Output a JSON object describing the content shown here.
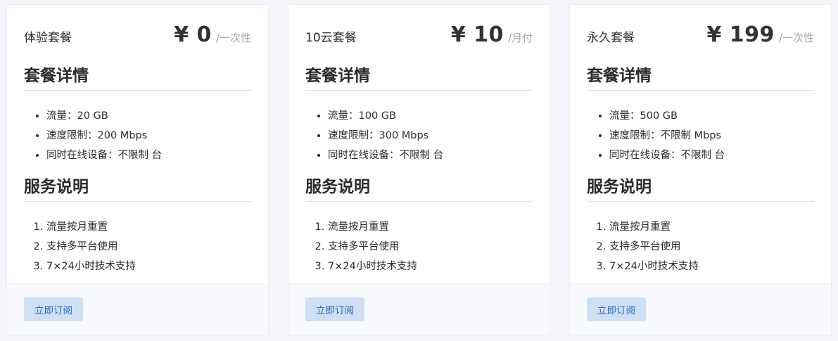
{
  "plans": [
    {
      "name": "体验套餐",
      "price": "¥ 0",
      "price_unit": "/一次性",
      "details_title": "套餐详情",
      "features": [
        "流量：20 GB",
        "速度限制：200 Mbps",
        "同时在线设备：不限制 台"
      ],
      "service_title": "服务说明",
      "services": [
        "流量按月重置",
        "支持多平台使用",
        "7×24小时技术支持"
      ],
      "subscribe_label": "立即订阅"
    },
    {
      "name": "10云套餐",
      "price": "¥ 10",
      "price_unit": "/月付",
      "details_title": "套餐详情",
      "features": [
        "流量：100 GB",
        "速度限制：300 Mbps",
        "同时在线设备：不限制 台"
      ],
      "service_title": "服务说明",
      "services": [
        "流量按月重置",
        "支持多平台使用",
        "7×24小时技术支持"
      ],
      "subscribe_label": "立即订阅"
    },
    {
      "name": "永久套餐",
      "price": "¥ 199",
      "price_unit": "/一次性",
      "details_title": "套餐详情",
      "features": [
        "流量：500 GB",
        "速度限制：不限制 Mbps",
        "同时在线设备：不限制 台"
      ],
      "service_title": "服务说明",
      "services": [
        "流量按月重置",
        "支持多平台使用",
        "7×24小时技术支持"
      ],
      "subscribe_label": "立即订阅"
    }
  ],
  "colors": {
    "button_bg": "#cfe0f5",
    "button_text": "#2f6cb8",
    "page_bg": "#f4f5fa"
  }
}
